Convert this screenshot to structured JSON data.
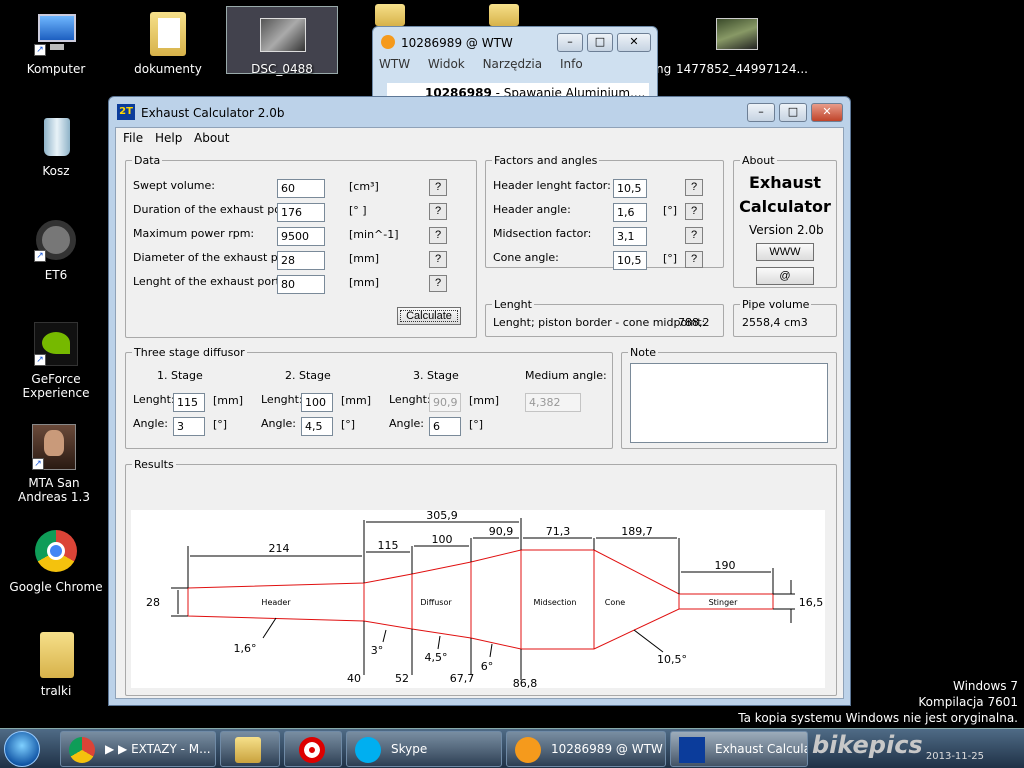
{
  "desktop": {
    "icons": [
      {
        "label": "Komputer",
        "icon": "computer-icon"
      },
      {
        "label": "dokumenty",
        "icon": "folder-icon"
      },
      {
        "label": "DSC_0488",
        "icon": "image-icon"
      },
      {
        "label": "ng",
        "icon": "app-icon"
      },
      {
        "label": "1477852_44997124...",
        "icon": "image-icon"
      },
      {
        "label": "Kosz",
        "icon": "recycle-bin-icon"
      },
      {
        "label": "ET6",
        "icon": "steering-wheel-icon"
      },
      {
        "label": "GeForce Experience",
        "icon": "nvidia-icon"
      },
      {
        "label": "MTA San Andreas 1.3",
        "icon": "game-icon"
      },
      {
        "label": "Google Chrome",
        "icon": "chrome-icon"
      },
      {
        "label": "tralki",
        "icon": "folder-icon"
      }
    ],
    "watermark": [
      "Windows 7",
      "Kompilacja 7601",
      "Ta kopia systemu Windows nie jest oryginalna."
    ]
  },
  "taskbar": {
    "buttons": [
      {
        "label": "▶ ▶ EXTAZY - M...",
        "icon": "chrome-icon"
      },
      {
        "label": "",
        "icon": "explorer-icon"
      },
      {
        "label": "",
        "icon": "opera-icon"
      },
      {
        "label": "Skype",
        "icon": "skype-icon"
      },
      {
        "label": "10286989 @ WTW",
        "icon": "wtw-icon"
      },
      {
        "label": "Exhaust Calculato",
        "icon": "app-2t-icon"
      }
    ],
    "clock": "2013-11-25",
    "brand": "bikepics"
  },
  "wtw_window": {
    "title": "10286989 @ WTW",
    "menu": [
      "WTW",
      "Widok",
      "Narzędzia",
      "Info"
    ],
    "row_id": "10286989",
    "row_text": "- Spawanie Aluminium...."
  },
  "window": {
    "logo": "2T",
    "title": "Exhaust Calculator 2.0b",
    "menu": [
      "File",
      "Help",
      "About"
    ],
    "data_group": {
      "title": "Data",
      "rows": [
        {
          "label": "Swept volume:",
          "value": "60",
          "unit": "[cm³]"
        },
        {
          "label": "Duration of the exhaust port:",
          "value": "176",
          "unit": "[° ]"
        },
        {
          "label": "Maximum power rpm:",
          "value": "9500",
          "unit": "[min^-1]"
        },
        {
          "label": "Diameter of the exhaust port:",
          "value": "28",
          "unit": "[mm]"
        },
        {
          "label": "Lenght of the exhaust port:",
          "value": "80",
          "unit": "[mm]"
        }
      ],
      "help": "?",
      "calculate": "Calculate"
    },
    "factors_group": {
      "title": "Factors and angles",
      "rows": [
        {
          "label": "Header lenght factor:",
          "value": "10,5",
          "unit": ""
        },
        {
          "label": "Header angle:",
          "value": "1,6",
          "unit": "[°]"
        },
        {
          "label": "Midsection factor:",
          "value": "3,1",
          "unit": ""
        },
        {
          "label": "Cone angle:",
          "value": "10,5",
          "unit": "[°]"
        }
      ]
    },
    "about_group": {
      "title": "About",
      "line1": "Exhaust",
      "line2": "Calculator",
      "version": "Version 2.0b",
      "www": "WWW",
      "mail": "@"
    },
    "lenght_group": {
      "title": "Lenght",
      "text": "Lenght; piston border - cone midpoint:",
      "value": "788,2"
    },
    "pipe_group": {
      "title": "Pipe volume",
      "value": "2558,4 cm3"
    },
    "diffusor_group": {
      "title": "Three stage diffusor",
      "stages": [
        {
          "name": "1. Stage",
          "lenght": "115",
          "angle": "3"
        },
        {
          "name": "2. Stage",
          "lenght": "100",
          "angle": "4,5"
        },
        {
          "name": "3. Stage",
          "lenght": "90,9",
          "angle": "6"
        }
      ],
      "lenght_label": "Lenght:",
      "angle_label": "Angle:",
      "mm_unit": "[mm]",
      "deg_unit": "[°]",
      "medium_label": "Medium angle:",
      "medium_value": "4,382"
    },
    "note_group": {
      "title": "Note",
      "text": ""
    },
    "results_group": {
      "title": "Results"
    }
  },
  "diagram": {
    "sections": [
      "Header",
      "Diffusor",
      "Midsection",
      "Cone",
      "Stinger"
    ],
    "dims": {
      "header": "214",
      "stage1": "115",
      "stage2": "100",
      "stage3": "90,9",
      "diffusor_total": "305,9",
      "midsection": "71,3",
      "cone": "189,7",
      "stinger": "190",
      "inlet_diameter": "28",
      "stinger_diameter": "16,5"
    },
    "diameters": {
      "d1": "40",
      "d2": "52",
      "d3": "67,7",
      "d4": "86,8"
    },
    "angles": {
      "header": "1,6°",
      "stage1": "3°",
      "stage2": "4,5°",
      "stage3": "6°",
      "cone": "10,5°"
    }
  }
}
